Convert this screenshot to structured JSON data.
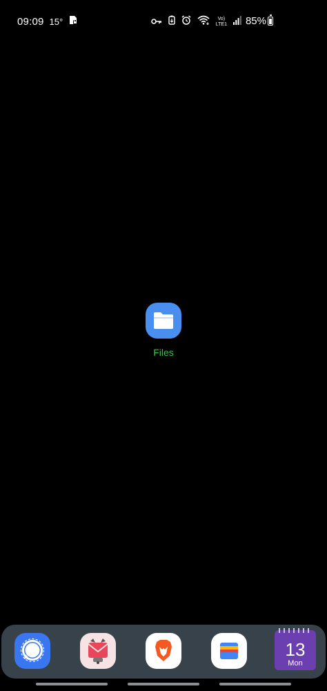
{
  "status_bar": {
    "time": "09:09",
    "temperature": "15°",
    "battery_percent": "85%",
    "network_label_top": "Vo)",
    "network_label_bottom": "LTE1",
    "icons": [
      "sd-card-lock-icon",
      "key-icon",
      "battery-saver-icon",
      "alarm-icon",
      "wifi-icon",
      "volte-icon",
      "signal-icon",
      "battery-icon"
    ]
  },
  "home": {
    "app": {
      "label": "Files",
      "icon": "folder-icon",
      "icon_color": "#4a8ef0",
      "label_color": "#38c24a"
    }
  },
  "dock": {
    "apps": [
      {
        "name": "signal",
        "icon": "chat-bubble-icon",
        "color": "#3a76f0"
      },
      {
        "name": "k9-mail",
        "icon": "mail-icon",
        "color": "#f7e3e3"
      },
      {
        "name": "brave",
        "icon": "lion-icon",
        "color": "#ffffff"
      },
      {
        "name": "wallet",
        "icon": "wallet-icon",
        "color": "#ffffff"
      },
      {
        "name": "calendar",
        "icon": "calendar-icon",
        "color": "#6c3fb0"
      }
    ],
    "calendar": {
      "day": "13",
      "weekday": "Mon"
    }
  },
  "navigation": {
    "handles": [
      "back",
      "home",
      "recents"
    ]
  }
}
